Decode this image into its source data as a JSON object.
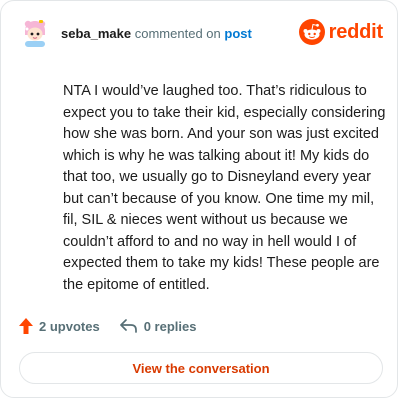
{
  "header": {
    "username": "seba_make",
    "action_text": "commented on",
    "post_link": "post",
    "brand": "reddit"
  },
  "comment": {
    "body": "NTA I would’ve laughed too. That’s ridiculous to expect you to take their kid, especially considering how she was born. And your son was just excited which is why he was talking about it! My kids do that too, we usually go to Disneyland every year but can’t because of you know. One time my mil, fil, SIL & nieces went without us because we couldn’t afford to and no way in hell would I of expected them to take my kids! These people are the epitome of entitled."
  },
  "actions": {
    "upvotes_label": "2 upvotes",
    "replies_label": "0 replies",
    "upvote_icon": "upvote-arrow-icon",
    "reply_icon": "reply-arrow-icon"
  },
  "cta": {
    "label": "View the conversation"
  },
  "colors": {
    "brand": "#ff4500",
    "link": "#0079d3",
    "cta": "#d93a00",
    "muted": "#576f76"
  }
}
